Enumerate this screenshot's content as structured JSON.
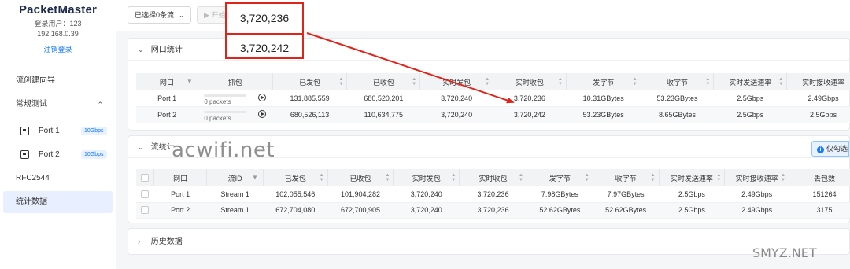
{
  "app": {
    "name": "PacketMaster",
    "user": "登录用户：123",
    "ip": "192.168.0.39",
    "logout": "注销登录"
  },
  "sidebar": {
    "wizard": "流创建向导",
    "routine": "常规测试",
    "ports": [
      {
        "label": "Port 1",
        "speed": "10Gbps"
      },
      {
        "label": "Port 2",
        "speed": "10Gbps"
      }
    ],
    "rfc": "RFC2544",
    "stats": "统计数据"
  },
  "toolbar": {
    "selected_flows": "已选择0条流",
    "start": "开始"
  },
  "port_stats": {
    "title": "网口统计",
    "columns": [
      "网口",
      "抓包",
      "已发包",
      "已收包",
      "实时发包",
      "实时收包",
      "发字节",
      "收字节",
      "实时发送速率",
      "实时接收速率"
    ],
    "rows": [
      {
        "port": "Port 1",
        "capture": "0 packets",
        "sent": "131,885,559",
        "recv": "680,520,201",
        "rt_sent": "3,720,240",
        "rt_recv": "3,720,236",
        "tx_bytes": "10.31GBytes",
        "rx_bytes": "53.23GBytes",
        "tx_rate": "2.5Gbps",
        "rx_rate": "2.49Gbps"
      },
      {
        "port": "Port 2",
        "capture": "0 packets",
        "sent": "680,526,113",
        "recv": "110,634,775",
        "rt_sent": "3,720,240",
        "rt_recv": "3,720,242",
        "tx_bytes": "53.23GBytes",
        "rx_bytes": "8.65GBytes",
        "tx_rate": "2.5Gbps",
        "rx_rate": "2.5Gbps"
      }
    ]
  },
  "flow_stats": {
    "title": "流统计",
    "only_button": "仅勾选",
    "columns": [
      "网口",
      "流ID",
      "已发包",
      "已收包",
      "实时发包",
      "实时收包",
      "发字节",
      "收字节",
      "实时发送速率",
      "实时接收速率",
      "丢包数"
    ],
    "rows": [
      {
        "port": "Port 1",
        "flow": "Stream 1",
        "sent": "102,055,546",
        "recv": "101,904,282",
        "rt_sent": "3,720,240",
        "rt_recv": "3,720,236",
        "tx_bytes": "7.98GBytes",
        "rx_bytes": "7.97GBytes",
        "tx_rate": "2.5Gbps",
        "rx_rate": "2.49Gbps",
        "loss": "151264"
      },
      {
        "port": "Port 2",
        "flow": "Stream 1",
        "sent": "672,704,080",
        "recv": "672,700,905",
        "rt_sent": "3,720,240",
        "rt_recv": "3,720,236",
        "tx_bytes": "52.62GBytes",
        "rx_bytes": "52.62GBytes",
        "tx_rate": "2.5Gbps",
        "rx_rate": "2.49Gbps",
        "loss": "3175"
      }
    ]
  },
  "history": {
    "title": "历史数据"
  },
  "callout": {
    "value1": "3,720,236",
    "value2": "3,720,242",
    "color": "#e0241a"
  },
  "watermarks": {
    "center": "acwifi.net",
    "corner": "SMYZ.NET"
  }
}
